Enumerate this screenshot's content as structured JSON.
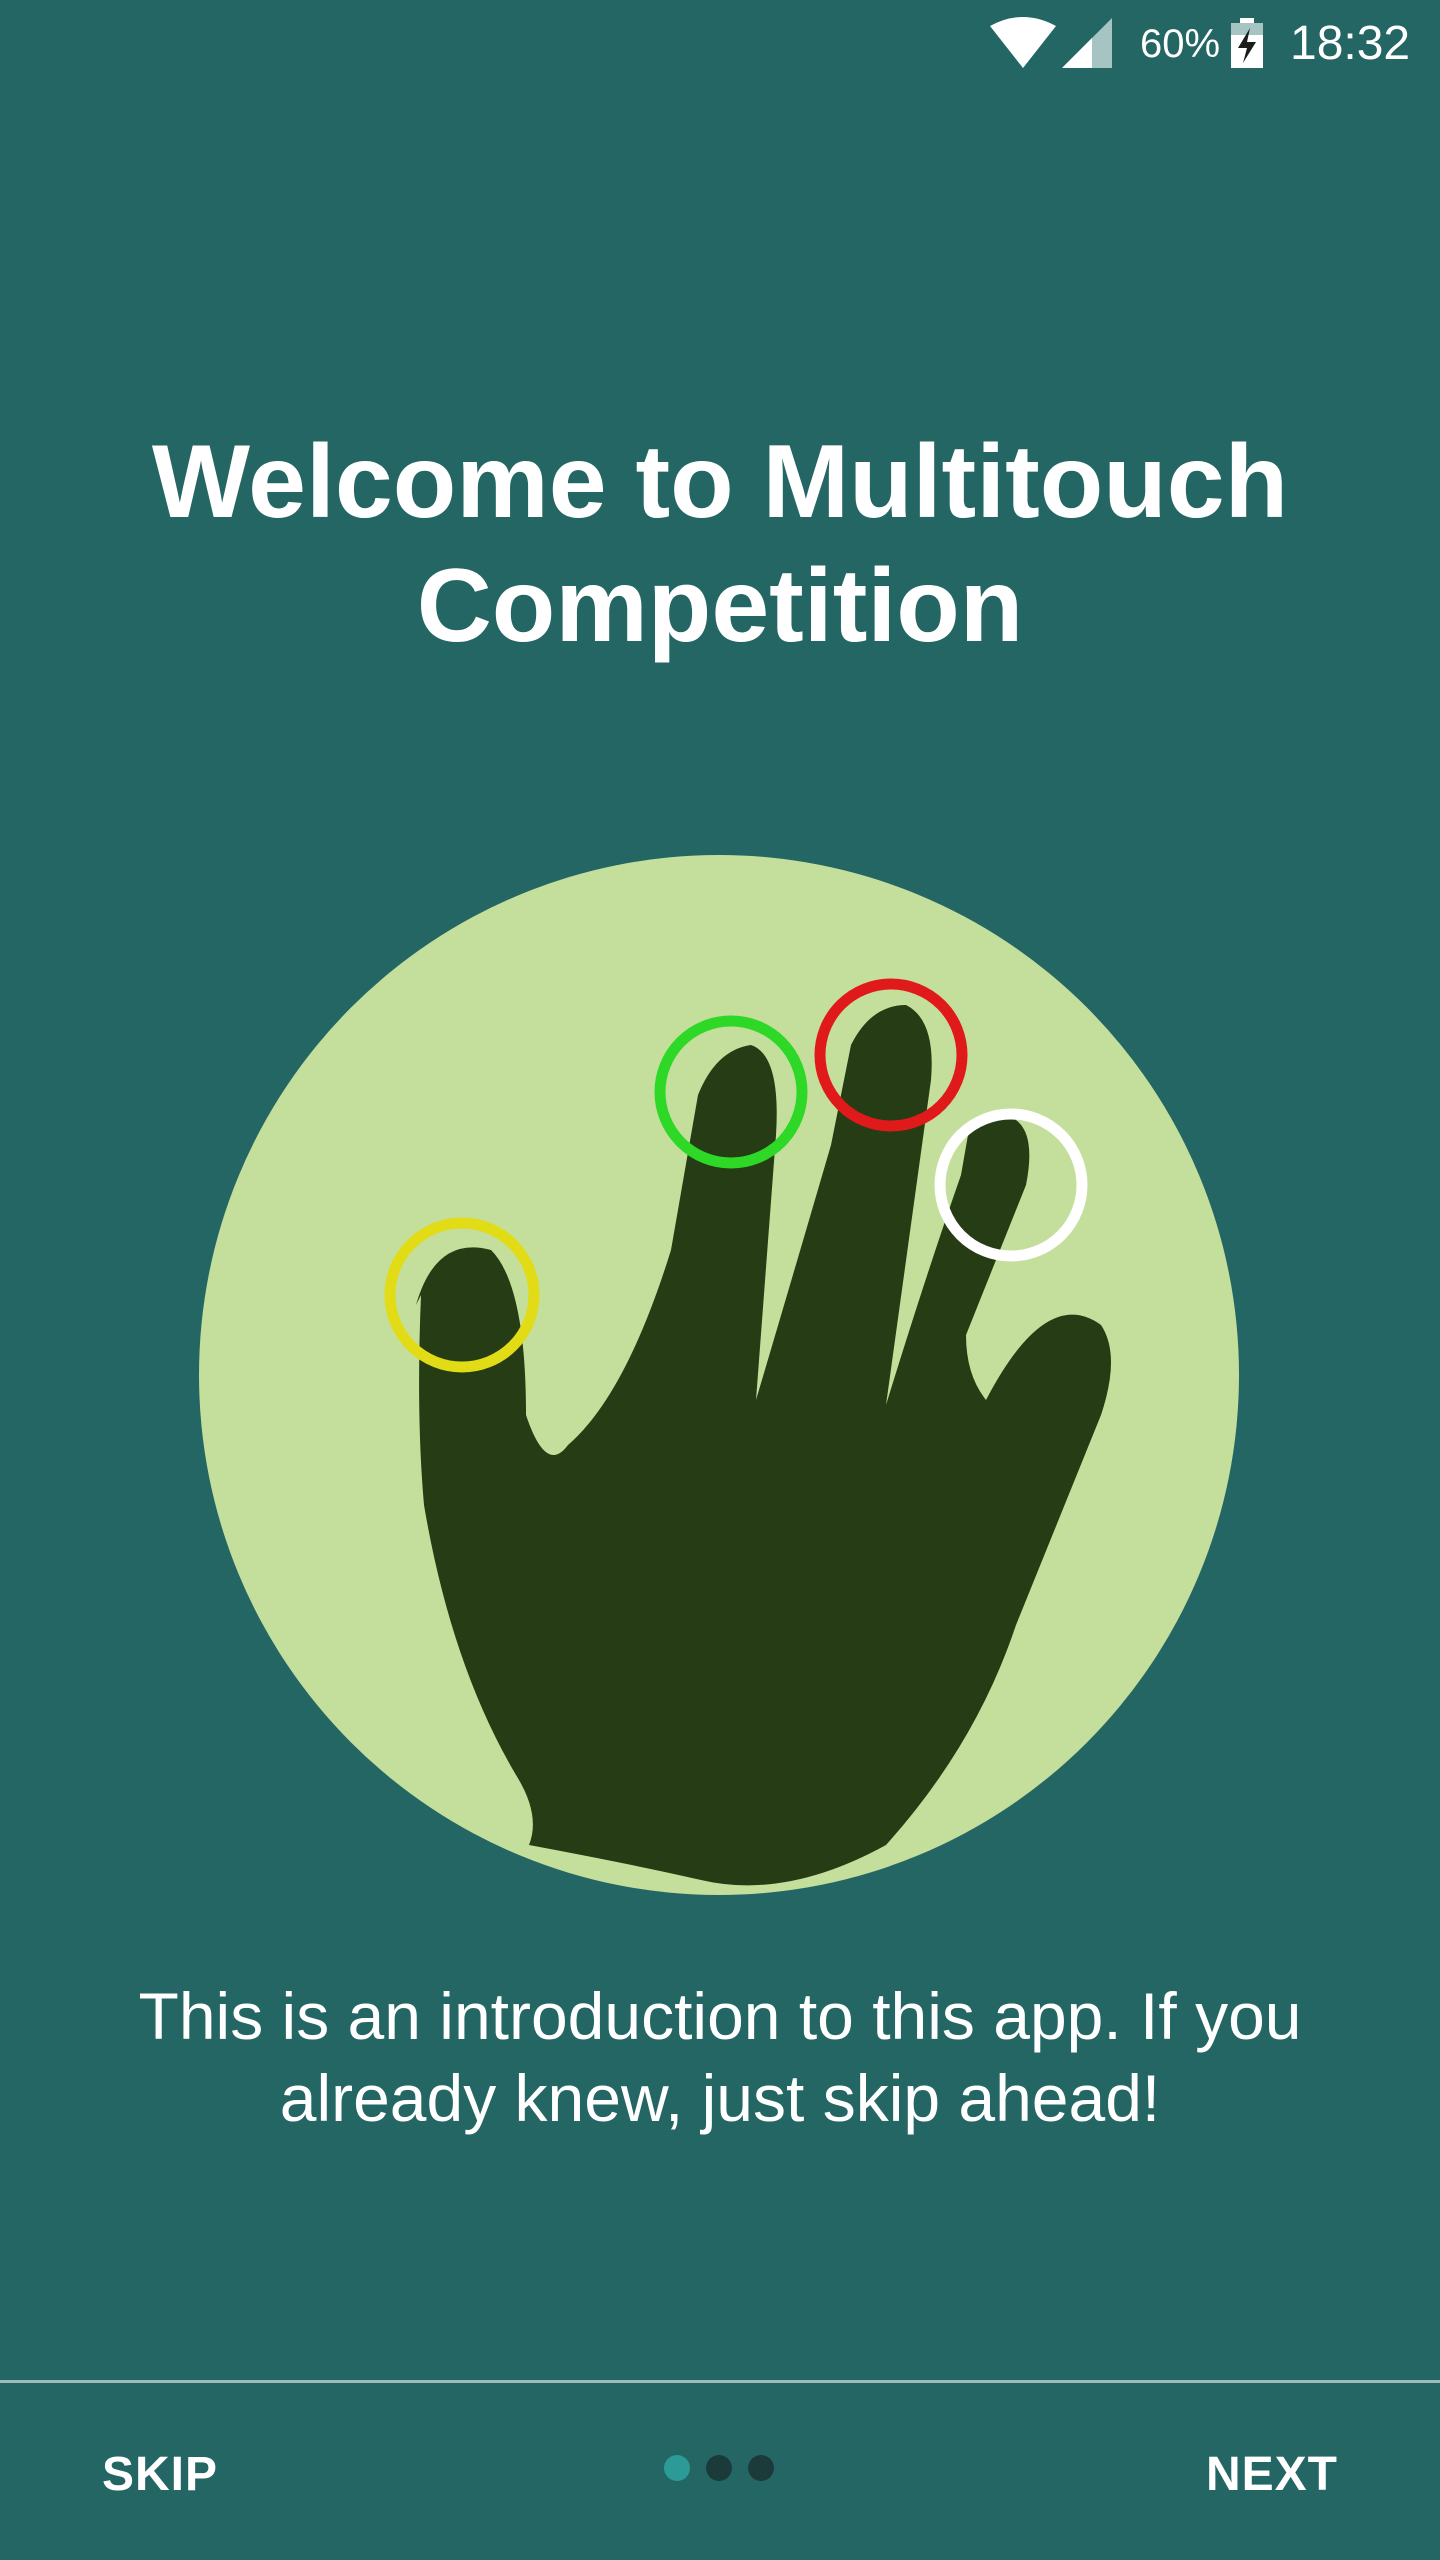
{
  "status_bar": {
    "battery_percent": "60%",
    "time": "18:32",
    "icons": [
      "wifi-icon",
      "cell-signal-icon",
      "battery-charging-icon"
    ]
  },
  "intro": {
    "title": "Welcome to Multitouch Competition",
    "description": "This is an introduction to this app. If you already knew, just skip ahead!",
    "illustration": "multitouch-hand-illustration",
    "touch_colors": [
      "#e2dc16",
      "#2ed826",
      "#e01a1a",
      "#ffffff"
    ]
  },
  "navigation": {
    "skip_label": "SKIP",
    "next_label": "NEXT",
    "page_count": 3,
    "current_page": 1
  },
  "colors": {
    "background": "#246664",
    "circle": "#c4de9c",
    "hand": "#253c14",
    "indicator_active": "#2c9a96",
    "indicator_inactive": "#1b3b3a"
  }
}
